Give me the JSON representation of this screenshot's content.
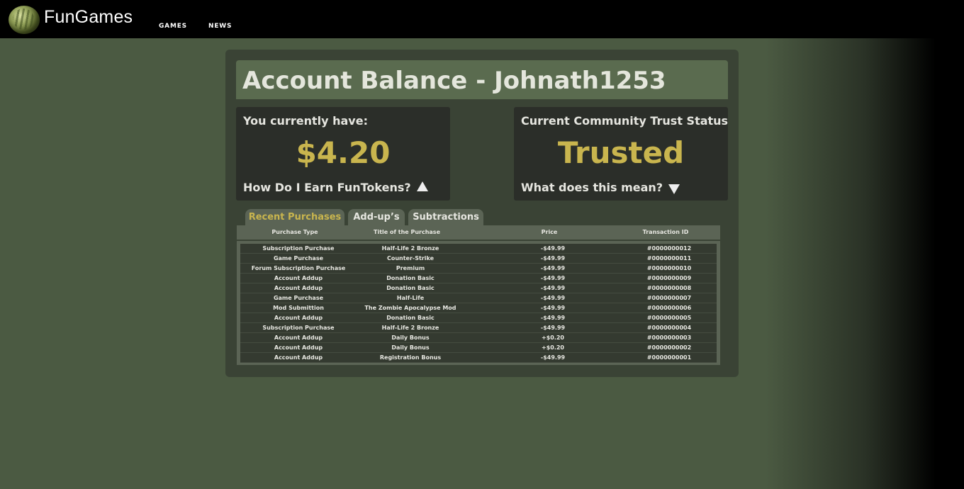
{
  "header": {
    "brand": "FunGames",
    "nav": [
      "GAMES",
      "NEWS"
    ]
  },
  "account": {
    "title": "Account Balance - Johnath1253",
    "balance_label": "You currently have:",
    "balance": "$4.20",
    "earn_link": "How Do I Earn FunTokens?",
    "trust_label": "Current Community Trust Status",
    "trust_status": "Trusted",
    "trust_link": "What does this mean?"
  },
  "tabs": [
    "Recent Purchases",
    "Add-up’s",
    "Subtractions"
  ],
  "table": {
    "columns": [
      "Purchase Type",
      "Title of the Purchase",
      "Price",
      "Transaction ID"
    ],
    "rows": [
      [
        "Subscription Purchase",
        "Half-Life 2 Bronze",
        "-$49.99",
        "#0000000012"
      ],
      [
        "Game Purchase",
        "Counter-Strike",
        "-$49.99",
        "#0000000011"
      ],
      [
        "Forum Subscription Purchase",
        "Premium",
        "-$49.99",
        "#0000000010"
      ],
      [
        "Account Addup",
        "Donation Basic",
        "-$49.99",
        "#0000000009"
      ],
      [
        "Account Addup",
        "Donation Basic",
        "-$49.99",
        "#0000000008"
      ],
      [
        "Game Purchase",
        "Half-Life",
        "-$49.99",
        "#0000000007"
      ],
      [
        "Mod Submittion",
        "The Zombie Apocalypse Mod",
        "-$49.99",
        "#0000000006"
      ],
      [
        "Account Addup",
        "Donation Basic",
        "-$49.99",
        "#0000000005"
      ],
      [
        "Subscription Purchase",
        "Half-Life 2 Bronze",
        "-$49.99",
        "#0000000004"
      ],
      [
        "Account Addup",
        "Daily Bonus",
        "+$0.20",
        "#0000000003"
      ],
      [
        "Account Addup",
        "Daily Bonus",
        "+$0.20",
        "#0000000002"
      ],
      [
        "Account Addup",
        "Registration Bonus",
        "-$49.99",
        "#0000000001"
      ]
    ]
  },
  "colors": {
    "accent": "#c9b54e",
    "page_bg": "#4b5a42",
    "panel_bg": "#3a4335",
    "title_bar": "#5a6b4f"
  },
  "icons": [
    "watermelon-logo-icon",
    "triangle-up-icon",
    "triangle-down-icon"
  ]
}
